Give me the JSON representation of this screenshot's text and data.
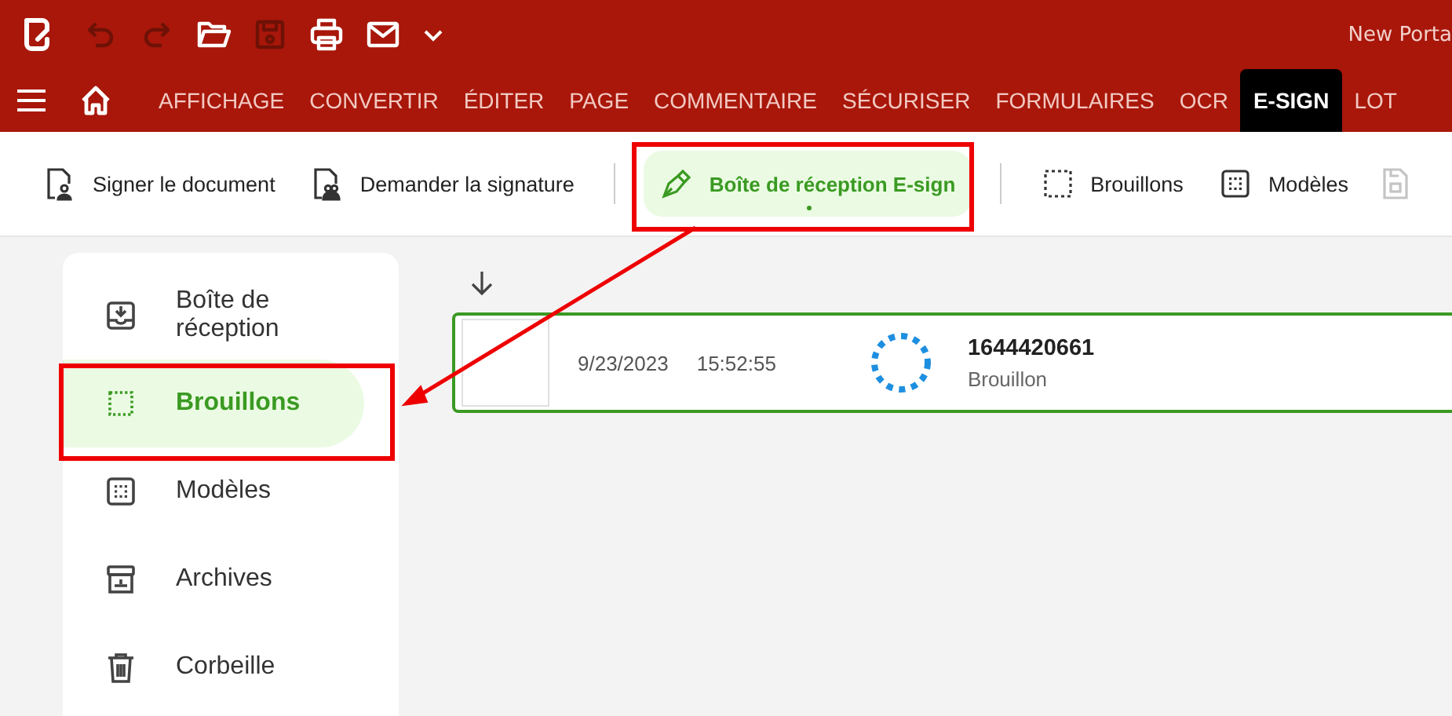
{
  "title_bar": {
    "quick_access": [
      {
        "disabled": true
      },
      {
        "disabled": true
      },
      {
        "disabled": false
      },
      {
        "disabled": true
      },
      {
        "disabled": false
      },
      {
        "disabled": false
      }
    ],
    "title": "New Porta"
  },
  "menu_tabs": [
    {
      "label": "AFFICHAGE",
      "selected": false
    },
    {
      "label": "CONVERTIR",
      "selected": false
    },
    {
      "label": "ÉDITER",
      "selected": false
    },
    {
      "label": "PAGE",
      "selected": false
    },
    {
      "label": "COMMENTAIRE",
      "selected": false
    },
    {
      "label": "SÉCURISER",
      "selected": false
    },
    {
      "label": "FORMULAIRES",
      "selected": false
    },
    {
      "label": "OCR",
      "selected": false
    },
    {
      "label": "E-SIGN",
      "selected": true
    },
    {
      "label": "LOT",
      "selected": false
    }
  ],
  "toolbar": [
    {
      "kind": "button",
      "label": "Signer le document",
      "selected": false
    },
    {
      "kind": "button",
      "label": "Demander la signature",
      "selected": false
    },
    {
      "kind": "button",
      "label": "Boîte de réception E-sign",
      "selected": true
    },
    {
      "kind": "button",
      "label": "Brouillons",
      "selected": false
    },
    {
      "kind": "button",
      "label": "Modèles",
      "selected": false
    },
    {
      "kind": "icon",
      "disabled": true
    }
  ],
  "sidebar": {
    "items": [
      {
        "label": "Boîte de réception",
        "selected": false
      },
      {
        "label": "Brouillons",
        "selected": true
      },
      {
        "label": "Modèles",
        "selected": false
      },
      {
        "label": "Archives",
        "selected": false
      },
      {
        "label": "Corbeille",
        "selected": false
      }
    ]
  },
  "documents": [
    {
      "date": "9/23/2023",
      "time": "15:52:55",
      "title": "1644420661",
      "status": "Brouillon",
      "selected": true
    }
  ]
}
